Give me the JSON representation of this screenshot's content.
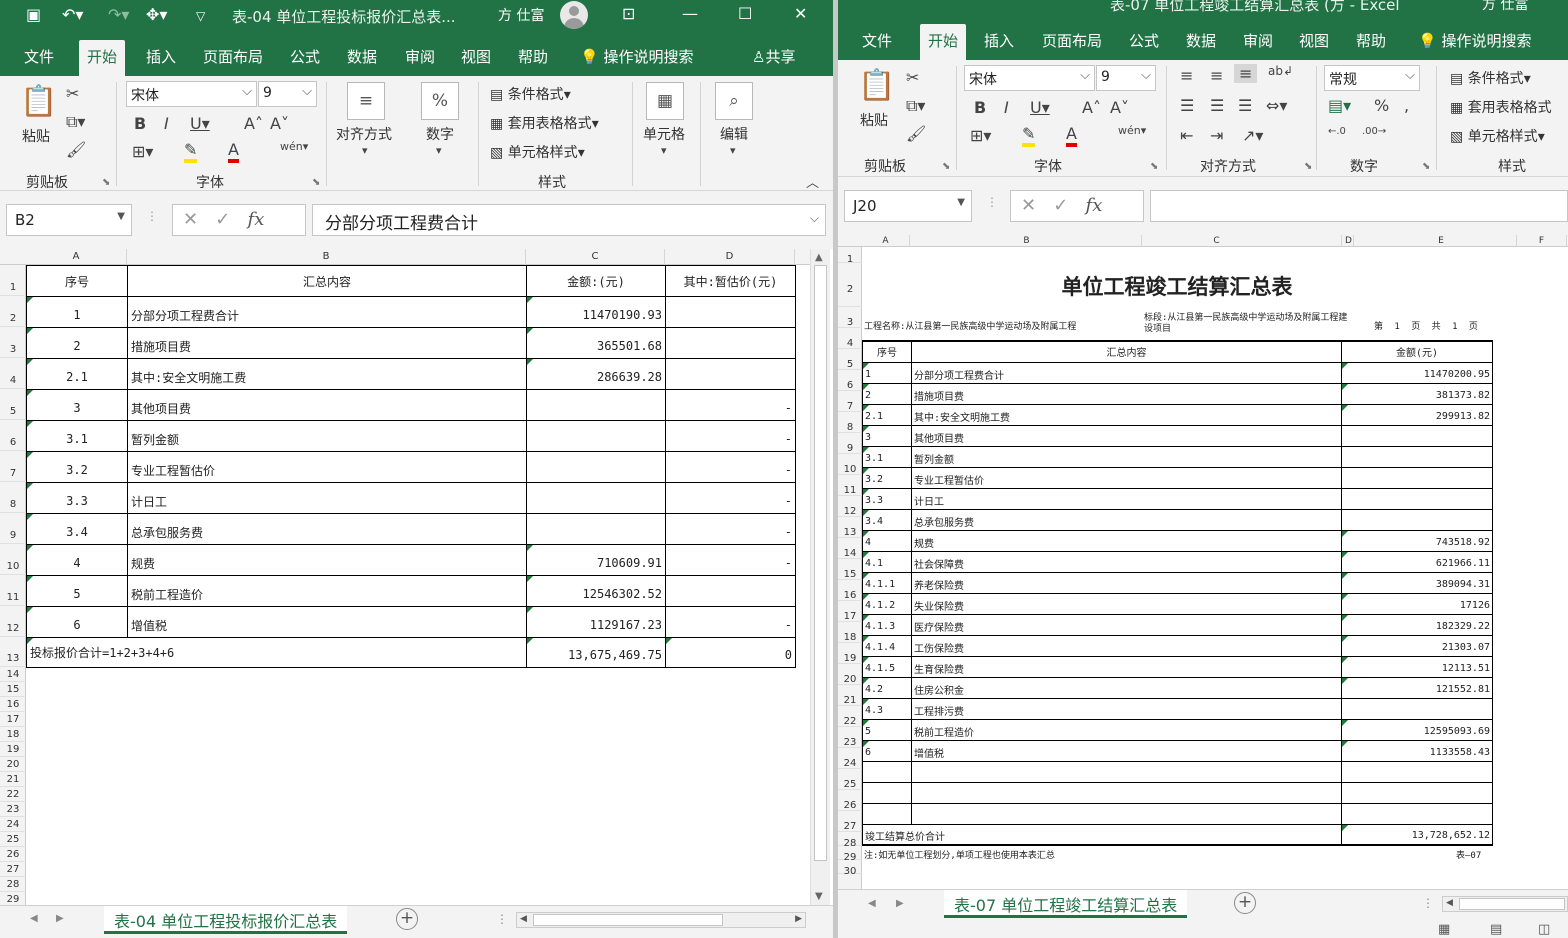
{
  "left": {
    "title": "表-04 单位工程投标报价汇总表...",
    "user": "方 仕富",
    "tabs": [
      "文件",
      "开始",
      "插入",
      "页面布局",
      "公式",
      "数据",
      "审阅",
      "视图",
      "帮助"
    ],
    "active_tab": "开始",
    "search": "操作说明搜索",
    "share": "共享",
    "ribbon": {
      "paste": "粘贴",
      "clipboard": "剪贴板",
      "font_name": "宋体",
      "font_size": "9",
      "font_group": "字体",
      "align": "对齐方式",
      "number": "数字",
      "cond_format": "条件格式",
      "table_format": "套用表格格式",
      "cell_style": "单元格样式",
      "styles_group": "样式",
      "cells": "单元格",
      "edit": "编辑"
    },
    "name_box": "B2",
    "formula": "分部分项工程费合计",
    "col_letters": [
      "A",
      "B",
      "C",
      "D"
    ],
    "row_numbers": [
      "1",
      "2",
      "3",
      "4",
      "5",
      "6",
      "7",
      "8",
      "9",
      "10",
      "11",
      "12",
      "13",
      "14",
      "15",
      "16",
      "17",
      "18",
      "19",
      "20",
      "21",
      "22",
      "23",
      "24",
      "25",
      "26",
      "27",
      "28",
      "29"
    ],
    "table": {
      "headers": [
        "序号",
        "汇总内容",
        "金额:(元)",
        "其中:暂估价(元)"
      ],
      "rows": [
        [
          "1",
          "分部分项工程费合计",
          "11470190.93",
          ""
        ],
        [
          "2",
          "措施项目费",
          "365501.68",
          ""
        ],
        [
          "2.1",
          "其中:安全文明施工费",
          "286639.28",
          ""
        ],
        [
          "3",
          "其他项目费",
          "",
          "-"
        ],
        [
          "3.1",
          "暂列金额",
          "",
          "-"
        ],
        [
          "3.2",
          "专业工程暂估价",
          "",
          "-"
        ],
        [
          "3.3",
          "计日工",
          "",
          "-"
        ],
        [
          "3.4",
          "总承包服务费",
          "",
          "-"
        ],
        [
          "4",
          "规费",
          "710609.91",
          "-"
        ],
        [
          "5",
          "税前工程造价",
          "12546302.52",
          ""
        ],
        [
          "6",
          "增值税",
          "1129167.23",
          "-"
        ]
      ],
      "total_label": "投标报价合计=1+2+3+4+6",
      "total_amount": "13,675,469.75",
      "total_estimate": "0"
    },
    "sheet_tab": "表-04 单位工程投标报价汇总表"
  },
  "right": {
    "title": "表-07 单位工程竣工结算汇总表 (方 - Excel",
    "user": "方 仕富",
    "tabs": [
      "文件",
      "开始",
      "插入",
      "页面布局",
      "公式",
      "数据",
      "审阅",
      "视图",
      "帮助"
    ],
    "active_tab": "开始",
    "search": "操作说明搜索",
    "ribbon": {
      "paste": "粘贴",
      "clipboard": "剪贴板",
      "font_name": "宋体",
      "font_size": "9",
      "font_group": "字体",
      "align_group": "对齐方式",
      "number_format": "常规",
      "number_group": "数字",
      "cond_format": "条件格式",
      "table_format": "套用表格格式",
      "cell_style": "单元格样式",
      "styles_group": "样式"
    },
    "name_box": "J20",
    "col_letters": [
      "A",
      "B",
      "C",
      "D",
      "E",
      "F"
    ],
    "row_numbers": [
      "1",
      "2",
      "3",
      "4",
      "5",
      "6",
      "7",
      "8",
      "9",
      "10",
      "11",
      "12",
      "13",
      "14",
      "15",
      "16",
      "17",
      "18",
      "19",
      "20",
      "21",
      "22",
      "23",
      "24",
      "25",
      "26",
      "27",
      "28",
      "29",
      "30"
    ],
    "report_title": "单位工程竣工结算汇总表",
    "project_name": "工程名称:从江县第一民族高级中学运动场及附属工程",
    "section": "标段:从江县第一民族高级中学运动场及附属工程建设项目",
    "page_info": "第 1 页 共 1 页",
    "table": {
      "headers": [
        "序号",
        "汇总内容",
        "金额(元)"
      ],
      "rows": [
        [
          "1",
          "分部分项工程费合计",
          "11470200.95"
        ],
        [
          "2",
          "措施项目费",
          "381373.82"
        ],
        [
          "2.1",
          "其中:安全文明施工费",
          "299913.82"
        ],
        [
          "3",
          "其他项目费",
          ""
        ],
        [
          "3.1",
          "暂列金额",
          ""
        ],
        [
          "3.2",
          "专业工程暂估价",
          ""
        ],
        [
          "3.3",
          "计日工",
          ""
        ],
        [
          "3.4",
          "总承包服务费",
          ""
        ],
        [
          "4",
          "规费",
          "743518.92"
        ],
        [
          "4.1",
          "社会保障费",
          "621966.11"
        ],
        [
          "4.1.1",
          "养老保险费",
          "389094.31"
        ],
        [
          "4.1.2",
          "失业保险费",
          "17126"
        ],
        [
          "4.1.3",
          "医疗保险费",
          "182329.22"
        ],
        [
          "4.1.4",
          "工伤保险费",
          "21303.07"
        ],
        [
          "4.1.5",
          "生育保险费",
          "12113.51"
        ],
        [
          "4.2",
          "住房公积金",
          "121552.81"
        ],
        [
          "4.3",
          "工程排污费",
          ""
        ],
        [
          "5",
          "税前工程造价",
          "12595093.69"
        ],
        [
          "6",
          "增值税",
          "1133558.43"
        ],
        [
          "",
          "",
          ""
        ],
        [
          "",
          "",
          ""
        ],
        [
          "",
          "",
          ""
        ]
      ],
      "total_label": "竣工结算总价合计",
      "total_amount": "13,728,652.12"
    },
    "note": "注:如无单位工程划分,单项工程也使用本表汇总",
    "form_code": "表—07",
    "sheet_tab": "表-07 单位工程竣工结算汇总表"
  },
  "colors": {
    "excel_green": "#217346",
    "ribbon_bg": "#f3f3f3"
  }
}
